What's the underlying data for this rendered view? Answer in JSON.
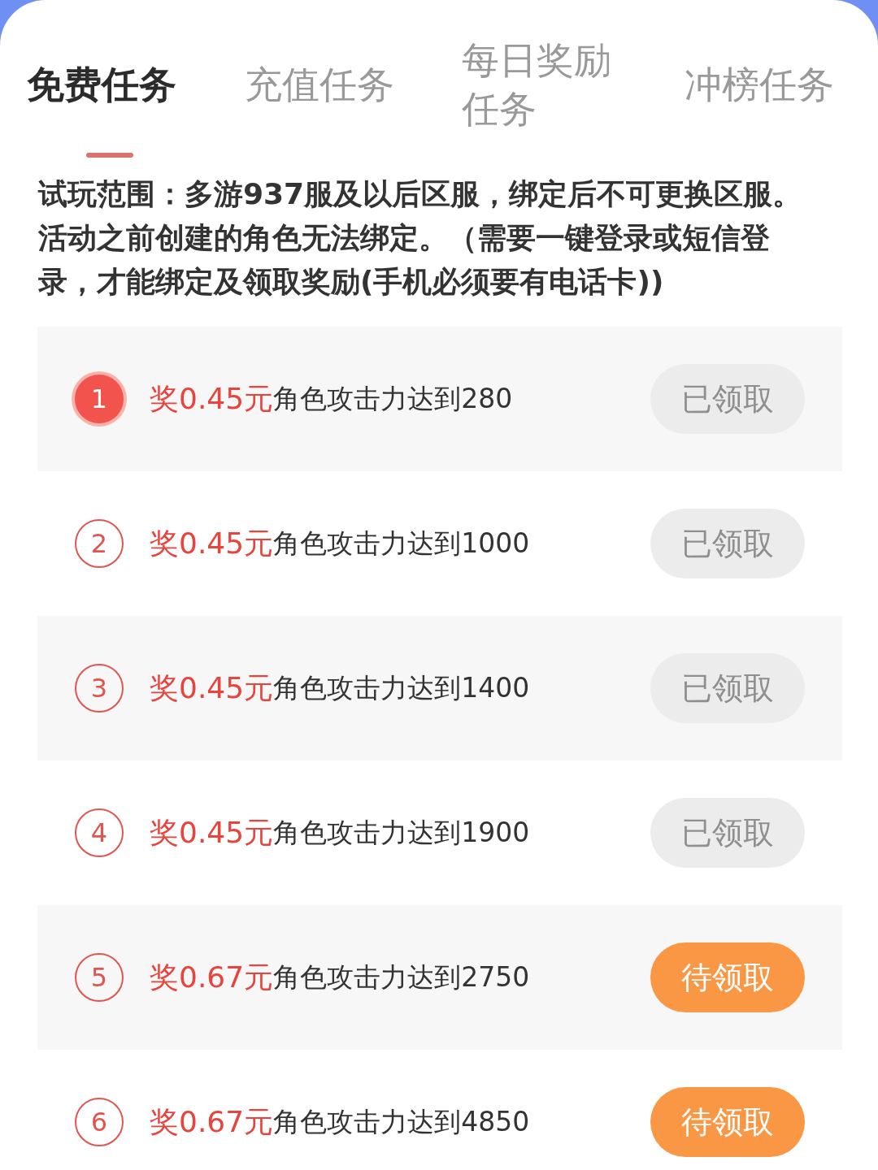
{
  "tabs": [
    {
      "label": "免费任务",
      "selected": true
    },
    {
      "label": "充值任务",
      "selected": false
    },
    {
      "label": "每日奖励任务",
      "selected": false
    },
    {
      "label": "冲榜任务",
      "selected": false
    }
  ],
  "description": "试玩范围：多游937服及以后区服，绑定后不可更换区服。活动之前创建的角色无法绑定。（需要一键登录或短信登录，才能绑定及领取奖励(手机必须要有电话卡))",
  "tasks": [
    {
      "number": "1",
      "highlighted": true,
      "reward": "奖0.45元",
      "condition": "角色攻击力达到280",
      "button": "已领取",
      "claimed": true
    },
    {
      "number": "2",
      "highlighted": false,
      "reward": "奖0.45元",
      "condition": "角色攻击力达到1000",
      "button": "已领取",
      "claimed": true
    },
    {
      "number": "3",
      "highlighted": false,
      "reward": "奖0.45元",
      "condition": "角色攻击力达到1400",
      "button": "已领取",
      "claimed": true
    },
    {
      "number": "4",
      "highlighted": false,
      "reward": "奖0.45元",
      "condition": "角色攻击力达到1900",
      "button": "已领取",
      "claimed": true
    },
    {
      "number": "5",
      "highlighted": false,
      "reward": "奖0.67元",
      "condition": "角色攻击力达到2750",
      "button": "待领取",
      "claimed": false
    },
    {
      "number": "6",
      "highlighted": false,
      "reward": "奖0.67元",
      "condition": "角色攻击力达到4850",
      "button": "待领取",
      "claimed": false
    }
  ]
}
